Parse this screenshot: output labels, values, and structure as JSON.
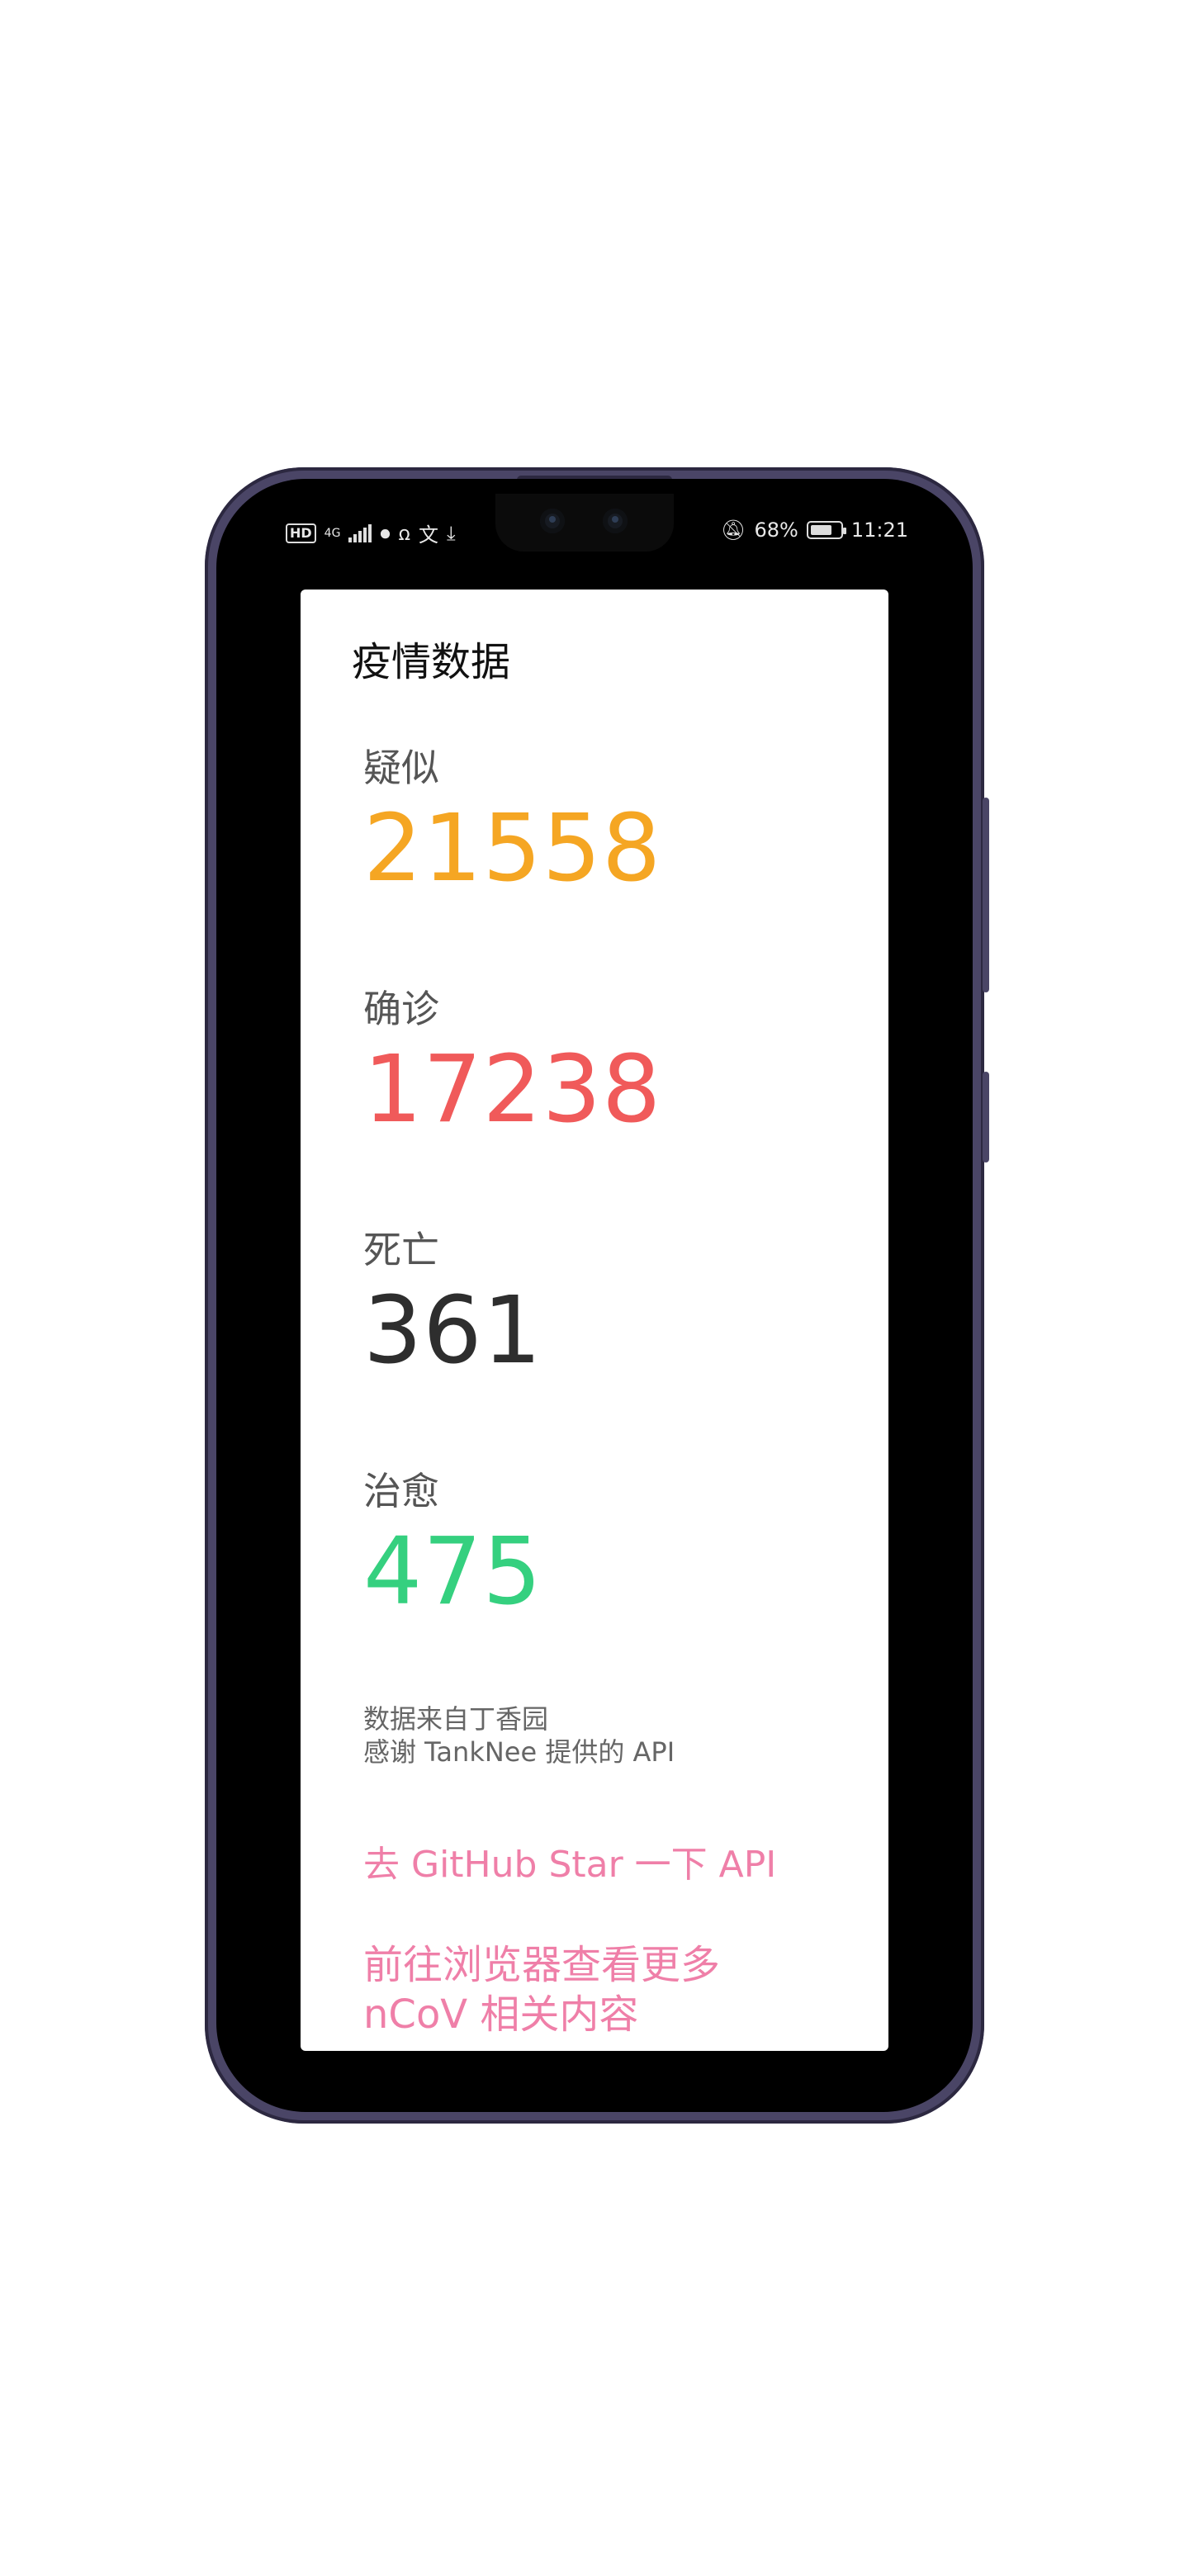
{
  "status_bar": {
    "left_icons": [
      "hd-icon",
      "signal-icon",
      "vpn-icon",
      "nfc-icon",
      "translate-icon",
      "download-icon"
    ],
    "hd_text": "HD",
    "network_text": "4G",
    "mute_icon": "bell-off-icon",
    "battery_percent": "68%",
    "time": "11:21"
  },
  "app": {
    "title": "疫情数据",
    "stats": [
      {
        "label": "疑似",
        "value": "21558",
        "color": "#F5A623"
      },
      {
        "label": "确诊",
        "value": "17238",
        "color": "#F05A5A"
      },
      {
        "label": "死亡",
        "value": "361",
        "color": "#2E2E2E"
      },
      {
        "label": "治愈",
        "value": "475",
        "color": "#35D07F"
      }
    ],
    "source_line1": "数据来自丁香园",
    "source_line2": "感谢 TankNee 提供的 API",
    "github_link": "去 GitHub Star 一下 API",
    "browser_link": "前往浏览器查看更多 nCoV 相关内容",
    "link_color": "#EF7FA8"
  }
}
